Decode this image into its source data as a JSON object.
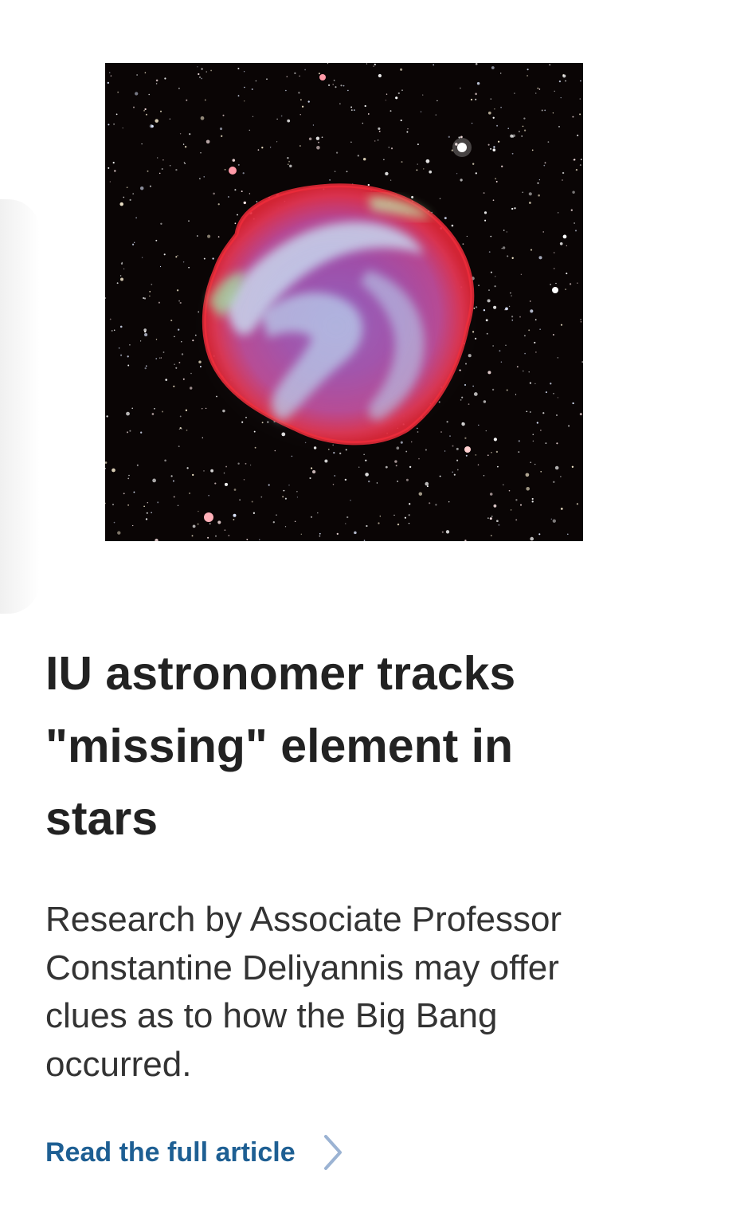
{
  "article": {
    "image": {
      "subject": "supernova-remnant-starfield"
    },
    "headline": "IU astronomer tracks \"missing\" element in stars",
    "summary": "Research by Associate Professor Constantine Deliyannis may offer clues as to how the Big Bang occurred.",
    "link": {
      "label": "Read the full article",
      "icon": "chevron-right-icon"
    }
  },
  "colors": {
    "headline": "#222222",
    "summary": "#333333",
    "link": "#1e5f93",
    "chevron": "#9bb3d3",
    "image_background": "#0a0505"
  }
}
